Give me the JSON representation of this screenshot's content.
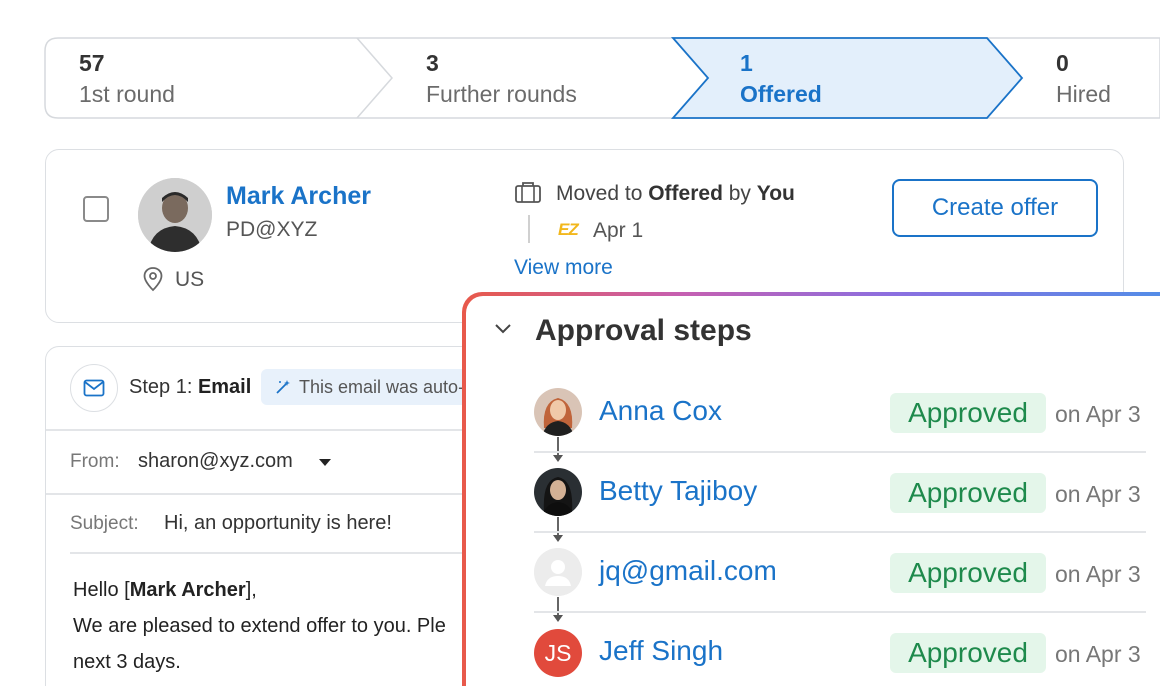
{
  "pipeline": {
    "stages": [
      {
        "count": "57",
        "label": "1st round",
        "active": false
      },
      {
        "count": "3",
        "label": "Further rounds",
        "active": false
      },
      {
        "count": "1",
        "label": "Offered",
        "active": true
      },
      {
        "count": "0",
        "label": "Hired",
        "active": false
      }
    ]
  },
  "candidate": {
    "name": "Mark Archer",
    "title": "PD@XYZ",
    "location": "US",
    "activity": {
      "prefix": "Moved to ",
      "stage": "Offered",
      "by_text": " by ",
      "actor": "You",
      "logo_text": "EZ",
      "date": "Apr 1"
    },
    "view_more": "View more",
    "create_offer": "Create offer"
  },
  "email": {
    "step_prefix": "Step 1: ",
    "step_type": "Email",
    "auto_badge": "This email was auto-",
    "from_label": "From:",
    "from_value": "sharon@xyz.com",
    "subject_label": "Subject:",
    "subject_value": "Hi, an opportunity is here!",
    "greeting_prefix": "Hello [",
    "greeting_name": "Mark Archer",
    "greeting_suffix": "],",
    "body_line1": "We are pleased to extend offer to you. Ple",
    "body_line2": "next 3 days."
  },
  "approval": {
    "title": "Approval steps",
    "steps": [
      {
        "name": "Anna Cox",
        "status": "Approved",
        "date": "on Apr 3"
      },
      {
        "name": "Betty Tajiboy",
        "status": "Approved",
        "date": "on Apr 3"
      },
      {
        "name": "jq@gmail.com",
        "status": "Approved",
        "date": "on Apr 3"
      },
      {
        "name": "Jeff Singh",
        "status": "Approved",
        "date": "on Apr 3",
        "initials": "JS"
      }
    ]
  },
  "colors": {
    "accent": "#1a73c8",
    "active_stage_bg": "#e3effb",
    "approved_bg": "#e4f6ea",
    "approved_text": "#1e8a4c",
    "initials_bg": "#e14a3c"
  },
  "icons": {
    "checkbox": "checkbox-icon",
    "location": "location-pin-icon",
    "briefcase": "briefcase-icon",
    "mail": "mail-icon",
    "magic": "magic-wand-icon",
    "caret": "caret-down-icon",
    "chevron": "chevron-down-icon",
    "placeholder_user": "user-placeholder-icon"
  }
}
